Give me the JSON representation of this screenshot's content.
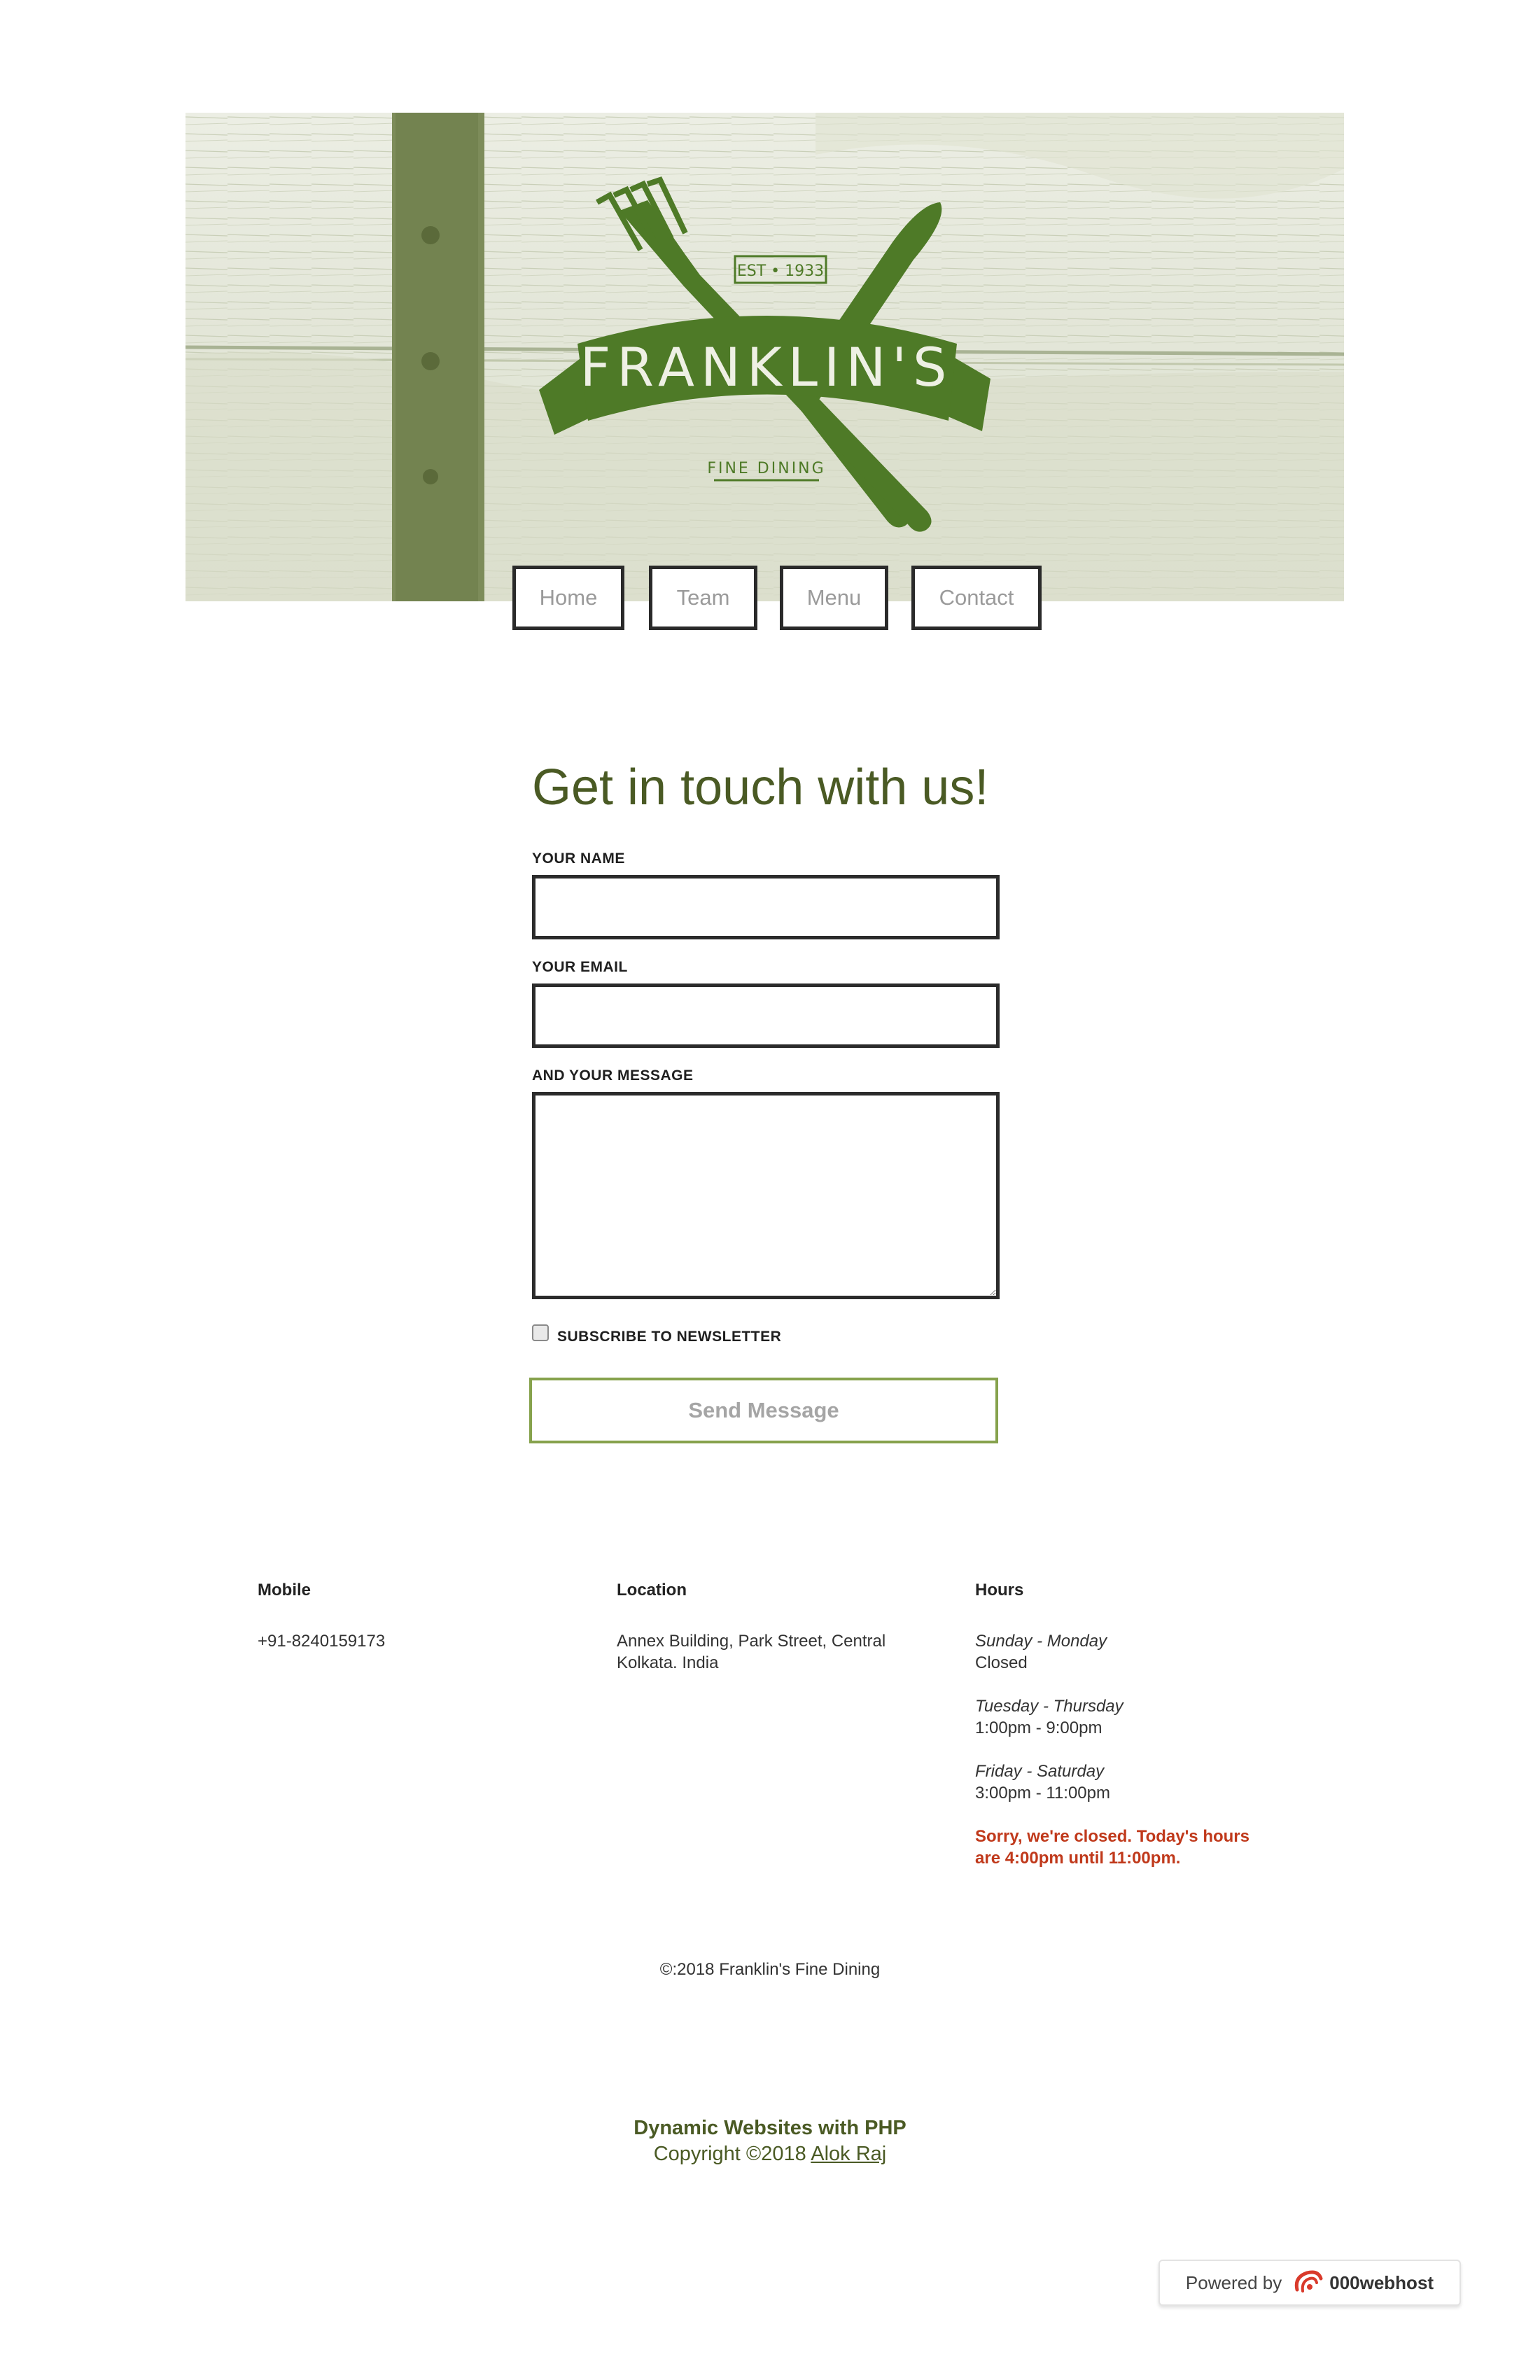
{
  "header": {
    "logo": {
      "name": "FRANKLIN'S",
      "established": "EST • 1933",
      "tagline": "FINE DINING"
    }
  },
  "nav": {
    "items": [
      {
        "label": "Home"
      },
      {
        "label": "Team"
      },
      {
        "label": "Menu"
      },
      {
        "label": "Contact"
      }
    ]
  },
  "form": {
    "title": "Get in touch with us!",
    "name_label": "YOUR NAME",
    "name_value": "",
    "email_label": "YOUR EMAIL",
    "email_value": "",
    "message_label": "AND YOUR MESSAGE",
    "message_value": "",
    "subscribe_label": "SUBSCRIBE TO NEWSLETTER",
    "subscribe_checked": false,
    "send_label": "Send Message"
  },
  "info": {
    "mobile": {
      "heading": "Mobile",
      "value": "+91-8240159173"
    },
    "location": {
      "heading": "Location",
      "line1": "Annex Building, Park Street, Central",
      "line2": "Kolkata. India"
    },
    "hours": {
      "heading": "Hours",
      "schedule": [
        {
          "days": "Sunday - Monday",
          "time": "Closed"
        },
        {
          "days": "Tuesday - Thursday",
          "time": "1:00pm - 9:00pm"
        },
        {
          "days": "Friday - Saturday",
          "time": "3:00pm - 11:00pm"
        }
      ],
      "status_line1": "Sorry, we're closed. Today's hours",
      "status_line2": "are 4:00pm until 11:00pm."
    }
  },
  "footer": {
    "copyright": "©:2018 Franklin's Fine Dining",
    "credit_title": "Dynamic Websites with PHP",
    "credit_copyright": "Copyright ©2018",
    "credit_author": "Alok Raj"
  },
  "badge": {
    "powered_by": "Powered by",
    "brand": "000webhost"
  },
  "colors": {
    "brand_green": "#4e7a27",
    "heading_olive": "#4a5a24",
    "status_red": "#c0391b",
    "button_border": "#86a24c"
  },
  "icons": {
    "logo": "fork-knife-banner-logo",
    "badge": "webhost-logo-icon"
  }
}
